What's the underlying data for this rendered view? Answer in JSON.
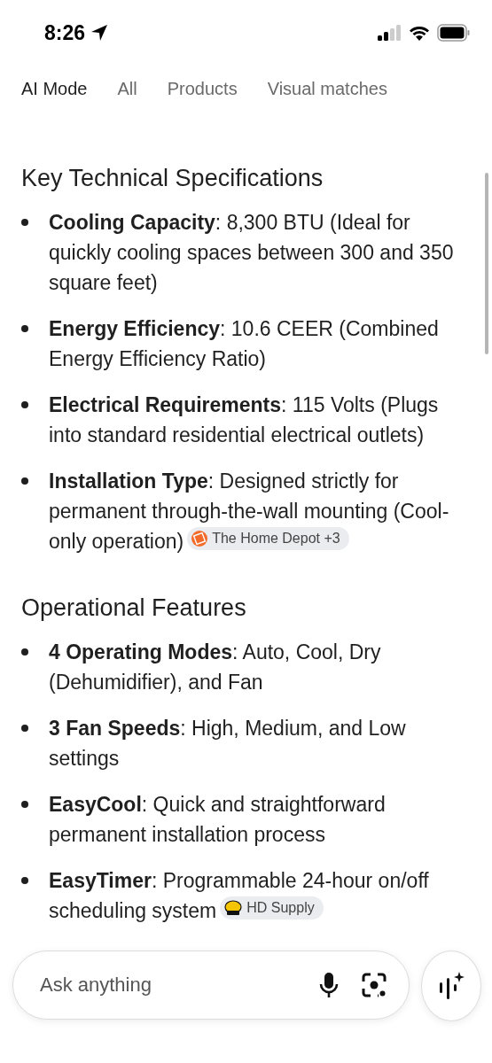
{
  "status_bar": {
    "time": "8:26"
  },
  "tabs": [
    {
      "label": "AI Mode",
      "selected": true
    },
    {
      "label": "All",
      "selected": false
    },
    {
      "label": "Products",
      "selected": false
    },
    {
      "label": "Visual matches",
      "selected": false
    }
  ],
  "sections": [
    {
      "heading": "Key Technical Specifications",
      "items": [
        {
          "text": "**Cooling Capacity**: 8,300 BTU (Ideal for quickly cooling spaces between 300 and 350 square feet)"
        },
        {
          "text": "**Energy Efficiency**: 10.6 CEER (Combined Energy Efficiency Ratio)"
        },
        {
          "text": "**Electrical Requirements**: 115 Volts (Plugs into standard residential electrical outlets)"
        },
        {
          "text": "**Installation Type**: Designed strictly for permanent through-the-wall mounting (Cool-only operation)",
          "source": {
            "label": "The Home Depot +3",
            "kind": "homedepot"
          }
        }
      ]
    },
    {
      "heading": "Operational Features",
      "items": [
        {
          "text": "**4 Operating Modes**: Auto, Cool, Dry (Dehumidifier), and Fan"
        },
        {
          "text": "**3 Fan Speeds**: High, Medium, and Low settings"
        },
        {
          "text": "**EasyCool**: Quick and straightforward permanent installation process"
        },
        {
          "text": "**EasyTimer**: Programmable 24-hour on/off scheduling system",
          "source": {
            "label": "HD Supply",
            "kind": "hdsupply"
          }
        }
      ]
    }
  ],
  "ask_bar": {
    "placeholder": "Ask anything"
  }
}
